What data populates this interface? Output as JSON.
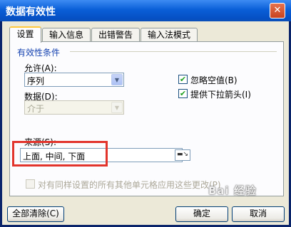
{
  "window": {
    "title": "数据有效性",
    "close_glyph": "✕"
  },
  "tabs": [
    {
      "label": "设置"
    },
    {
      "label": "输入信息"
    },
    {
      "label": "出错警告"
    },
    {
      "label": "输入法模式"
    }
  ],
  "group": {
    "label": "有效性条件"
  },
  "allow": {
    "label": "允许(A):",
    "value": "序列"
  },
  "data": {
    "label": "数据(D):",
    "value": "介于"
  },
  "source": {
    "label": "来源(S):",
    "value": "上面, 中间, 下面"
  },
  "options": {
    "ignore_blank": {
      "label": "忽略空值(B)",
      "checked": true
    },
    "in_cell_dropdown": {
      "label": "提供下拉箭头(I)",
      "checked": true
    },
    "apply_all": {
      "label": "对有同样设置的所有其他单元格应用这些更改(P)",
      "checked": false
    }
  },
  "buttons": {
    "clear_all": "全部清除(C)",
    "ok": "确定",
    "cancel": "取消"
  },
  "watermark": "Bai 经验"
}
